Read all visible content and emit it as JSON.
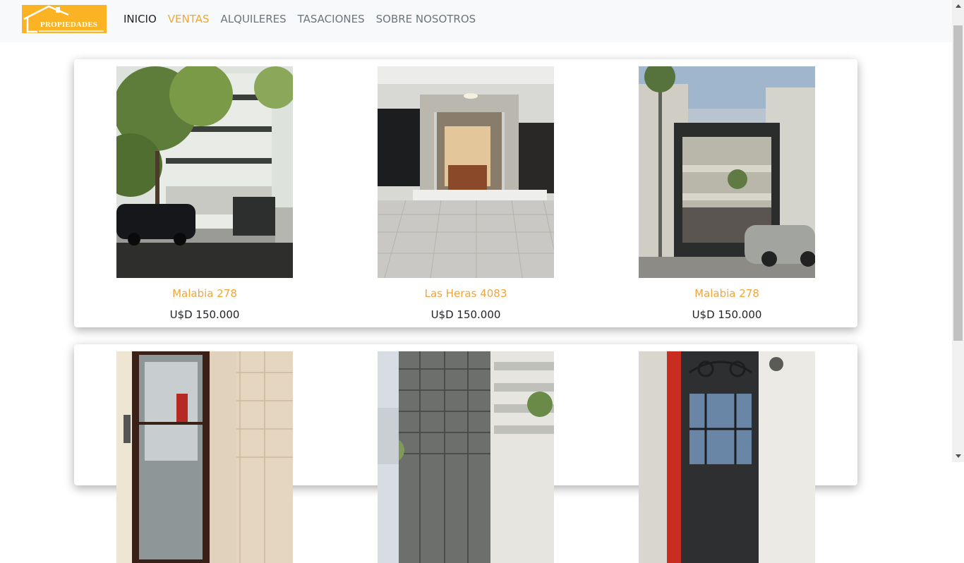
{
  "brand": {
    "logo_text": "PROPIEDADES",
    "logo_color": "#fbb324"
  },
  "nav": {
    "items": [
      {
        "label": "INICIO",
        "state": "home"
      },
      {
        "label": "VENTAS",
        "state": "active"
      },
      {
        "label": "ALQUILERES",
        "state": "normal"
      },
      {
        "label": "TASACIONES",
        "state": "normal"
      },
      {
        "label": "SOBRE NOSOTROS",
        "state": "normal"
      }
    ],
    "accent_color": "#f0a63c"
  },
  "listings": [
    {
      "title": "Malabia 278",
      "price": "U$D 150.000",
      "image": "building-with-trees-and-cars"
    },
    {
      "title": "Las Heras 4083",
      "price": "U$D 150.000",
      "image": "building-entrance-lobby"
    },
    {
      "title": "Malabia 278",
      "price": "U$D 150.000",
      "image": "modern-facade-with-car"
    },
    {
      "image": "interior-glass-door"
    },
    {
      "image": "glass-facade-tower"
    },
    {
      "image": "ornate-iron-gate"
    }
  ]
}
